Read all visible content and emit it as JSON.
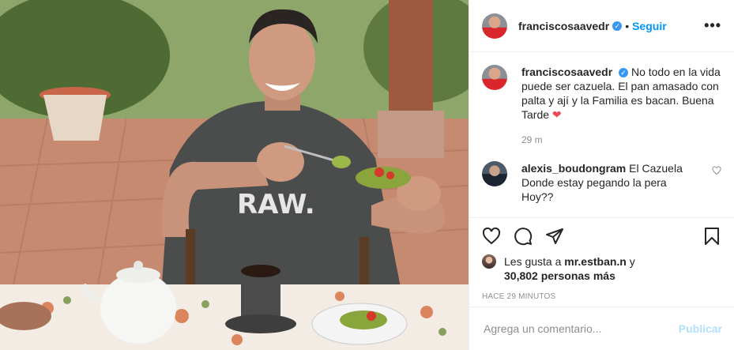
{
  "post": {
    "author": "franciscosaavedr",
    "follow_label": "Seguir",
    "separator": "•",
    "more_label": "•••",
    "caption": "No todo en la vida puede ser cazuela. El pan amasado con palta y ají y la Familia es bacan. Buena Tarde",
    "caption_emoji": "❤",
    "caption_time": "29 m"
  },
  "comments": [
    {
      "user": "alexis_boudongram",
      "text": "El Cazuela Donde estay pegando la pera Hoy??"
    }
  ],
  "likes": {
    "prefix": "Les gusta a",
    "user": "mr.estban.n",
    "conj": "y",
    "count": "30,802 personas más"
  },
  "timestamp": "HACE 29 MINUTOS",
  "comment_box": {
    "placeholder": "Agrega un comentario...",
    "publish_label": "Publicar"
  },
  "colors": {
    "accent": "#0095f6",
    "verified": "#3897f0",
    "heart": "#ed4956"
  },
  "icons": [
    "heart-icon",
    "comment-icon",
    "share-icon",
    "bookmark-icon",
    "verified-icon",
    "more-icon"
  ]
}
